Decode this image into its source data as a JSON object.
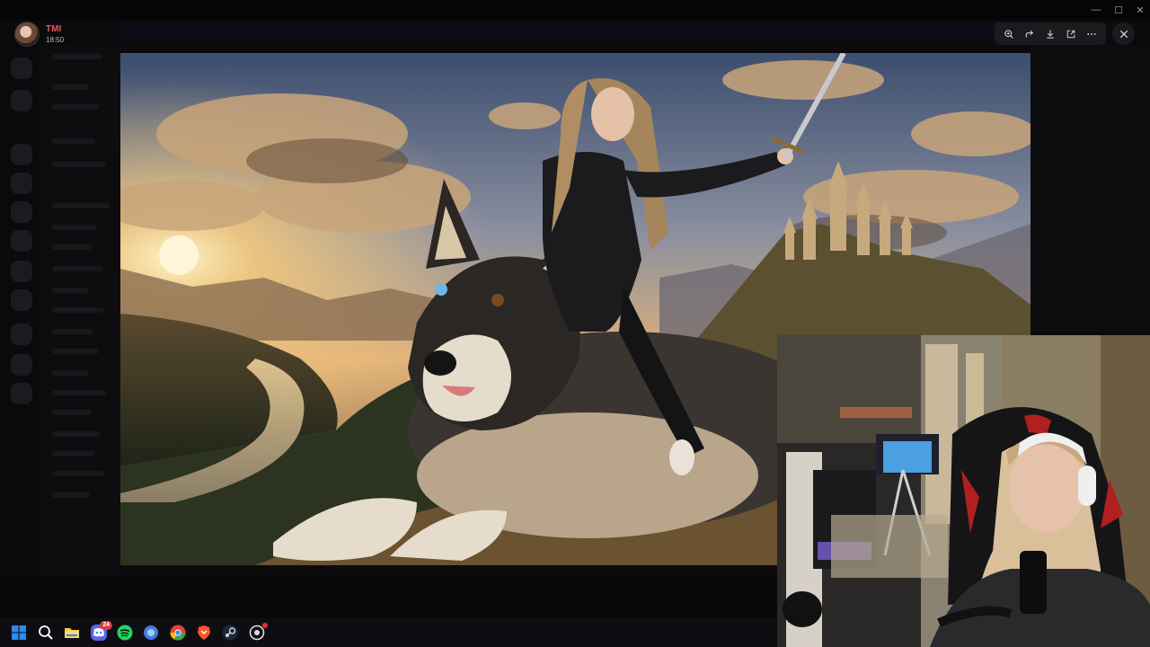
{
  "viewer": {
    "username": "TMI",
    "timestamp": "18:50",
    "toolbar": [
      {
        "name": "zoom-in-icon",
        "icon": "zoom-in"
      },
      {
        "name": "forward-icon",
        "icon": "forward"
      },
      {
        "name": "download-icon",
        "icon": "download"
      },
      {
        "name": "open-external-icon",
        "icon": "open-external"
      },
      {
        "name": "more-options-icon",
        "icon": "more"
      }
    ],
    "close_icon": "close"
  },
  "window": {
    "minimize": "—",
    "maximize": "☐",
    "close": "✕"
  },
  "taskbar": {
    "apps": [
      {
        "name": "windows-start-icon",
        "color": "#2b8cf0"
      },
      {
        "name": "search-icon",
        "color": "#ffffff"
      },
      {
        "name": "file-explorer-icon",
        "color": "#f5c542"
      },
      {
        "name": "discord-icon",
        "color": "#5865f2",
        "badge": "24"
      },
      {
        "name": "spotify-icon",
        "color": "#1ed760"
      },
      {
        "name": "app-blue-orb-icon",
        "color": "#3f7fe0"
      },
      {
        "name": "chrome-icon",
        "color": "#ea4335"
      },
      {
        "name": "brave-icon",
        "color": "#fb542b"
      },
      {
        "name": "steam-icon",
        "color": "#c7d5e0"
      },
      {
        "name": "app-notification-icon",
        "color": "#dddddd",
        "dot": true
      }
    ]
  },
  "colors": {
    "username": "#e05a5a",
    "toolbar_bg": "#1b1b1f",
    "background": "#0b0b0d"
  }
}
